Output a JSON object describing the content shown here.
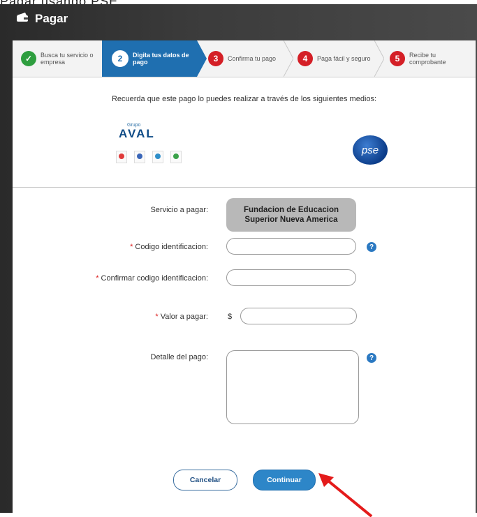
{
  "caption": "Pagar usando PSE",
  "window": {
    "title": "Pagar"
  },
  "stepper": [
    {
      "number": "✓",
      "label": "Busca tu servicio o empresa",
      "state": "done",
      "color": "#2e9e3f"
    },
    {
      "number": "2",
      "label": "Digita tus datos de pago",
      "state": "active",
      "color": "#ffffff"
    },
    {
      "number": "3",
      "label": "Confirma tu pago",
      "state": "pending",
      "color": "#d41f26"
    },
    {
      "number": "4",
      "label": "Paga fácil y seguro",
      "state": "pending",
      "color": "#d41f26"
    },
    {
      "number": "5",
      "label": "Recibe tu comprobante",
      "state": "pending",
      "color": "#d41f26"
    }
  ],
  "intro": "Recuerda que este pago lo puedes realizar a través de los siguientes medios:",
  "payment_methods": {
    "aval": {
      "small": "Grupo",
      "brand": "AVAL"
    },
    "pse": {
      "label": "pse"
    }
  },
  "form": {
    "service_label": "Servicio a pagar:",
    "service_value": "Fundacion de Educacion Superior Nueva America",
    "id_label": "Codigo identificacion:",
    "confirm_label": "Confirmar codigo identificacion:",
    "amount_label": "Valor a pagar:",
    "currency": "$",
    "detail_label": "Detalle del pago:",
    "required_mark": "*",
    "help_icon": "?"
  },
  "buttons": {
    "cancel": "Cancelar",
    "continue": "Continuar"
  },
  "colors": {
    "accent": "#1f6fb0",
    "required": "#d22222",
    "annotation_arrow": "#e41b1b"
  }
}
